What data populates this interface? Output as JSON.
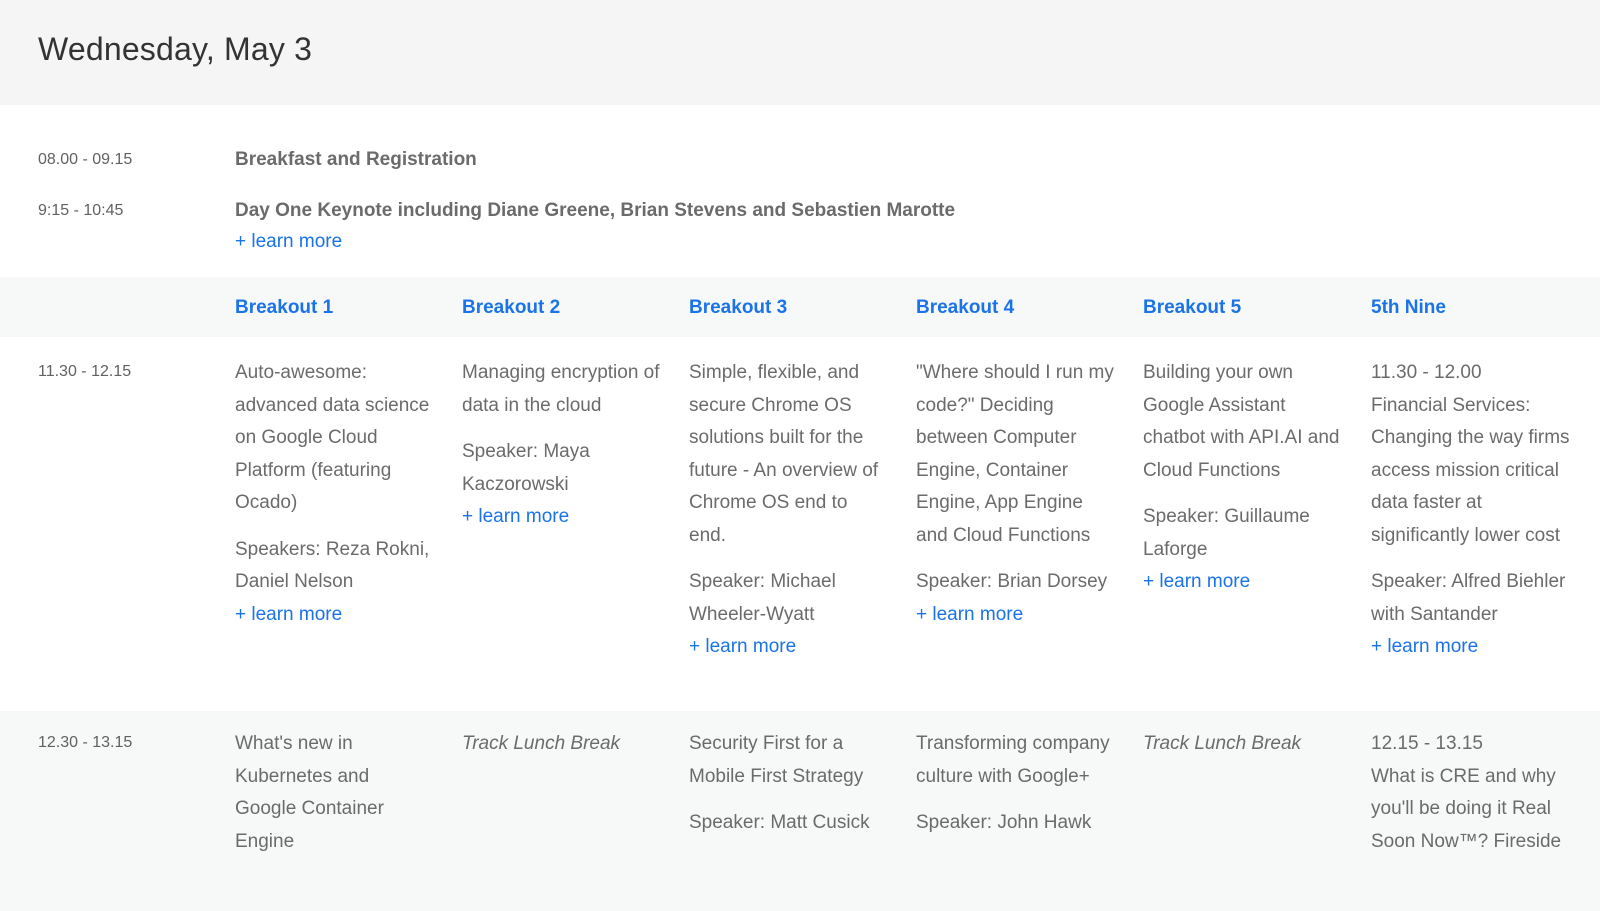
{
  "day": {
    "title": "Wednesday, May 3"
  },
  "plain_rows": [
    {
      "time": "08.00 - 09.15",
      "title": "Breakfast and Registration"
    },
    {
      "time": "9:15 - 10:45",
      "title": "Day One Keynote including Diane Greene, Brian Stevens and Sebastien Marotte",
      "learn_more": "+ learn more"
    }
  ],
  "tracks": [
    "Breakout 1",
    "Breakout 2",
    "Breakout 3",
    "Breakout 4",
    "Breakout 5",
    "5th Nine"
  ],
  "slot1": {
    "time": "11.30 - 12.15",
    "sessions": [
      {
        "title": "Auto-awesome: advanced data science on Google Cloud Platform (featuring Ocado)",
        "speaker": "Speakers: Reza Rokni, Daniel Nelson",
        "learn_more": "+ learn more"
      },
      {
        "title": "Managing encryption of data in the cloud",
        "speaker": "Speaker: Maya Kaczorowski",
        "learn_more": "+ learn more"
      },
      {
        "title": "Simple, flexible, and secure Chrome OS solutions built for the future - An overview of Chrome OS end to end.",
        "speaker": "Speaker: Michael Wheeler-Wyatt",
        "learn_more": "+ learn more"
      },
      {
        "title": "\"Where should I run my code?\" Deciding between Computer Engine, Container Engine, App Engine and Cloud Functions",
        "speaker": "Speaker: Brian Dorsey",
        "learn_more": "+ learn more"
      },
      {
        "title": "Building your own Google Assistant chatbot with API.AI and Cloud Functions",
        "speaker": "Speaker: Guillaume Laforge",
        "learn_more": "+ learn more"
      },
      {
        "time_note": "11.30 - 12.00",
        "title": "Financial Services: Changing the way firms access mission critical data faster at significantly lower cost",
        "speaker": "Speaker: Alfred Biehler with Santander",
        "learn_more": "+ learn more"
      }
    ]
  },
  "slot2": {
    "time": "12.30 - 13.15",
    "sessions": [
      {
        "title": "What's new in Kubernetes and Google Container Engine"
      },
      {
        "title": "Track Lunch Break"
      },
      {
        "title": "Security First for a Mobile First Strategy",
        "speaker": "Speaker: Matt Cusick"
      },
      {
        "title": "Transforming company culture with Google+",
        "speaker": "Speaker: John Hawk"
      },
      {
        "title": "Track Lunch Break"
      },
      {
        "time_note": "12.15 - 13.15",
        "title": "What is CRE and why you'll be doing it Real Soon Now™? Fireside"
      }
    ]
  }
}
